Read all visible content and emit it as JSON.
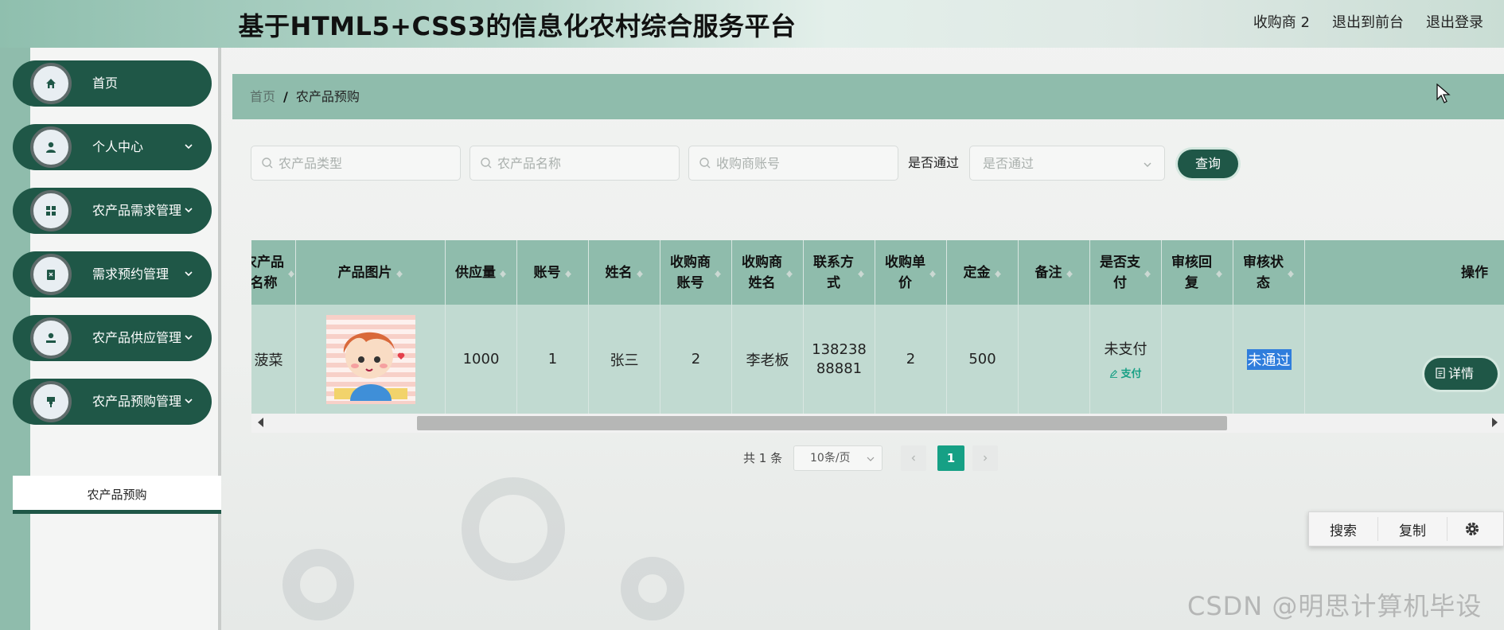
{
  "header": {
    "title": "基于HTML5+CSS3的信息化农村综合服务平台",
    "links": [
      "收购商 2",
      "退出到前台",
      "退出登录"
    ]
  },
  "sidebar": {
    "items": [
      {
        "label": "首页",
        "icon": "home-icon",
        "has_chevron": false
      },
      {
        "label": "个人中心",
        "icon": "user-icon",
        "has_chevron": true
      },
      {
        "label": "农产品需求管理",
        "icon": "grid-icon",
        "has_chevron": true
      },
      {
        "label": "需求预约管理",
        "icon": "clipboard-icon",
        "has_chevron": true
      },
      {
        "label": "农产品供应管理",
        "icon": "user-icon",
        "has_chevron": true
      },
      {
        "label": "农产品预购管理",
        "icon": "pin-icon",
        "has_chevron": true
      }
    ],
    "submenu_item": "农产品预购"
  },
  "breadcrumb": {
    "home": "首页",
    "separator": "/",
    "current": "农产品预购"
  },
  "search": {
    "placeholders": [
      "农产品类型",
      "农产品名称",
      "收购商账号"
    ],
    "approved_label": "是否通过",
    "approved_placeholder": "是否通过",
    "query_button": "查询"
  },
  "table": {
    "headers": [
      "农产品名称",
      "产品图片",
      "供应量",
      "账号",
      "姓名",
      "收购商账号",
      "收购商姓名",
      "联系方式",
      "收购单价",
      "定金",
      "备注",
      "是否支付",
      "审核回复",
      "审核状态",
      "操作"
    ],
    "header_display": [
      "农产品\n名称",
      "产品图片",
      "供应量",
      "账号",
      "姓名",
      "收购商\n账号",
      "收购商\n姓名",
      "联系方\n式",
      "收购单\n价",
      "定金",
      "备注",
      "是否支\n付",
      "审核回\n复",
      "审核状\n态",
      "操作"
    ],
    "rows": [
      {
        "name": "菠菜",
        "supply": "1000",
        "account": "1",
        "person": "张三",
        "buyer_account": "2",
        "buyer_name": "李老板",
        "phone": "13823888881",
        "phone_display": "138238\n88881",
        "unit_price": "2",
        "deposit": "500",
        "note": "",
        "paid": "未支付",
        "pay_action": "支付",
        "reply": "",
        "status": "未通过",
        "action": "详情"
      }
    ]
  },
  "pagination": {
    "total": "共 1 条",
    "page_size": "10条/页",
    "current_page": "1"
  },
  "toolbox": {
    "search": "搜索",
    "copy": "复制",
    "settings_icon": "gear-icon"
  },
  "watermark": "CSDN @明思计算机毕设",
  "colors": {
    "primary": "#1f5747",
    "accent": "#8fbcac",
    "row_bg": "#c1dad1",
    "pager_active": "#16a085",
    "pay_link": "#17a085",
    "status_highlight": "#2f7ddc"
  }
}
